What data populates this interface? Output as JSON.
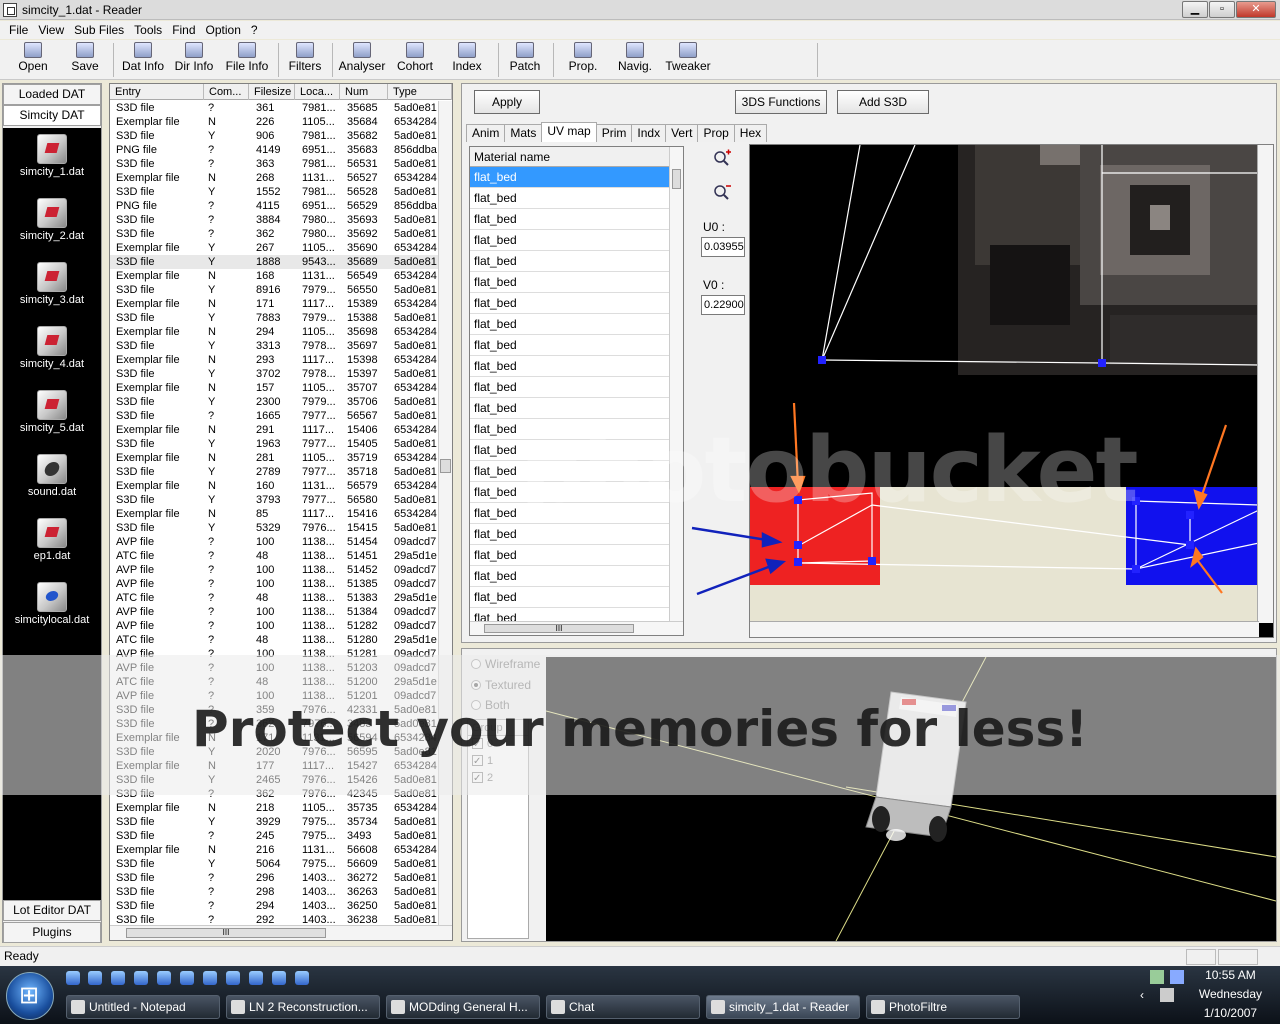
{
  "window": {
    "title": "simcity_1.dat - Reader",
    "btn_min": "▁",
    "btn_max": "▫",
    "btn_close": "✕"
  },
  "menu": [
    "File",
    "View",
    "Sub Files",
    "Tools",
    "Find",
    "Option",
    "?"
  ],
  "toolbar": {
    "buttons": [
      "Open",
      "Save",
      "Dat Info",
      "Dir Info",
      "File Info",
      "Filters",
      "Analyser",
      "Cohort",
      "Index",
      "Patch",
      "Prop.",
      "Navig.",
      "Tweaker"
    ]
  },
  "left_panel": {
    "tab_loaded": "Loaded DAT",
    "tab_simcity": "Simcity DAT",
    "files": [
      "simcity_1.dat",
      "simcity_2.dat",
      "simcity_3.dat",
      "simcity_4.dat",
      "simcity_5.dat",
      "sound.dat",
      "ep1.dat",
      "simcitylocal.dat"
    ],
    "tab_lot_editor": "Lot Editor DAT",
    "tab_plugins": "Plugins"
  },
  "entry_list": {
    "headers": [
      "Entry",
      "Com...",
      "Filesize",
      "Loca...",
      "Num",
      "Type"
    ],
    "rows": [
      [
        "S3D file",
        "?",
        "361",
        "7981...",
        "35685",
        "5ad0e81"
      ],
      [
        "Exemplar file",
        "N",
        "226",
        "1105...",
        "35684",
        "6534284"
      ],
      [
        "S3D file",
        "Y",
        "906",
        "7981...",
        "35682",
        "5ad0e81"
      ],
      [
        "PNG file",
        "?",
        "4149",
        "6951...",
        "35683",
        "856ddba"
      ],
      [
        "S3D file",
        "?",
        "363",
        "7981...",
        "56531",
        "5ad0e81"
      ],
      [
        "Exemplar file",
        "N",
        "268",
        "1131...",
        "56527",
        "6534284"
      ],
      [
        "S3D file",
        "Y",
        "1552",
        "7981...",
        "56528",
        "5ad0e81"
      ],
      [
        "PNG file",
        "?",
        "4115",
        "6951...",
        "56529",
        "856ddba"
      ],
      [
        "S3D file",
        "?",
        "3884",
        "7980...",
        "35693",
        "5ad0e81"
      ],
      [
        "S3D file",
        "?",
        "362",
        "7980...",
        "35692",
        "5ad0e81"
      ],
      [
        "Exemplar file",
        "Y",
        "267",
        "1105...",
        "35690",
        "6534284"
      ],
      [
        "S3D file",
        "Y",
        "1888",
        "9543...",
        "35689",
        "5ad0e81"
      ],
      [
        "Exemplar file",
        "N",
        "168",
        "1131...",
        "56549",
        "6534284"
      ],
      [
        "S3D file",
        "Y",
        "8916",
        "7979...",
        "56550",
        "5ad0e81"
      ],
      [
        "Exemplar file",
        "N",
        "171",
        "1117...",
        "15389",
        "6534284"
      ],
      [
        "S3D file",
        "Y",
        "7883",
        "7979...",
        "15388",
        "5ad0e81"
      ],
      [
        "Exemplar file",
        "N",
        "294",
        "1105...",
        "35698",
        "6534284"
      ],
      [
        "S3D file",
        "Y",
        "3313",
        "7978...",
        "35697",
        "5ad0e81"
      ],
      [
        "Exemplar file",
        "N",
        "293",
        "1117...",
        "15398",
        "6534284"
      ],
      [
        "S3D file",
        "Y",
        "3702",
        "7978...",
        "15397",
        "5ad0e81"
      ],
      [
        "Exemplar file",
        "N",
        "157",
        "1105...",
        "35707",
        "6534284"
      ],
      [
        "S3D file",
        "Y",
        "2300",
        "7979...",
        "35706",
        "5ad0e81"
      ],
      [
        "S3D file",
        "?",
        "1665",
        "7977...",
        "56567",
        "5ad0e81"
      ],
      [
        "Exemplar file",
        "N",
        "291",
        "1117...",
        "15406",
        "6534284"
      ],
      [
        "S3D file",
        "Y",
        "1963",
        "7977...",
        "15405",
        "5ad0e81"
      ],
      [
        "Exemplar file",
        "N",
        "281",
        "1105...",
        "35719",
        "6534284"
      ],
      [
        "S3D file",
        "Y",
        "2789",
        "7977...",
        "35718",
        "5ad0e81"
      ],
      [
        "Exemplar file",
        "N",
        "160",
        "1131...",
        "56579",
        "6534284"
      ],
      [
        "S3D file",
        "Y",
        "3793",
        "7977...",
        "56580",
        "5ad0e81"
      ],
      [
        "Exemplar file",
        "N",
        "85",
        "1117...",
        "15416",
        "6534284"
      ],
      [
        "S3D file",
        "Y",
        "5329",
        "7976...",
        "15415",
        "5ad0e81"
      ],
      [
        "AVP file",
        "?",
        "100",
        "1138...",
        "51454",
        "09adcd7"
      ],
      [
        "ATC file",
        "?",
        "48",
        "1138...",
        "51451",
        "29a5d1e"
      ],
      [
        "AVP file",
        "?",
        "100",
        "1138...",
        "51452",
        "09adcd7"
      ],
      [
        "AVP file",
        "?",
        "100",
        "1138...",
        "51385",
        "09adcd7"
      ],
      [
        "ATC file",
        "?",
        "48",
        "1138...",
        "51383",
        "29a5d1e"
      ],
      [
        "AVP file",
        "?",
        "100",
        "1138...",
        "51384",
        "09adcd7"
      ],
      [
        "AVP file",
        "?",
        "100",
        "1138...",
        "51282",
        "09adcd7"
      ],
      [
        "ATC file",
        "?",
        "48",
        "1138...",
        "51280",
        "29a5d1e"
      ],
      [
        "AVP file",
        "?",
        "100",
        "1138...",
        "51281",
        "09adcd7"
      ],
      [
        "AVP file",
        "?",
        "100",
        "1138...",
        "51203",
        "09adcd7"
      ],
      [
        "ATC file",
        "?",
        "48",
        "1138...",
        "51200",
        "29a5d1e"
      ],
      [
        "AVP file",
        "?",
        "100",
        "1138...",
        "51201",
        "09adcd7"
      ],
      [
        "S3D file",
        "?",
        "359",
        "7976...",
        "42331",
        "5ad0e81"
      ],
      [
        "S3D file",
        "?",
        "362",
        "7976...",
        "3483",
        "5ad0e81"
      ],
      [
        "Exemplar file",
        "N",
        "171",
        "1131...",
        "56594",
        "6534284"
      ],
      [
        "S3D file",
        "Y",
        "2020",
        "7976...",
        "56595",
        "5ad0e81"
      ],
      [
        "Exemplar file",
        "N",
        "177",
        "1117...",
        "15427",
        "6534284"
      ],
      [
        "S3D file",
        "Y",
        "2465",
        "7976...",
        "15426",
        "5ad0e81"
      ],
      [
        "S3D file",
        "?",
        "362",
        "7976...",
        "42345",
        "5ad0e81"
      ],
      [
        "Exemplar file",
        "N",
        "218",
        "1105...",
        "35735",
        "6534284"
      ],
      [
        "S3D file",
        "Y",
        "3929",
        "7975...",
        "35734",
        "5ad0e81"
      ],
      [
        "S3D file",
        "?",
        "245",
        "7975...",
        "3493",
        "5ad0e81"
      ],
      [
        "Exemplar file",
        "N",
        "216",
        "1131...",
        "56608",
        "6534284"
      ],
      [
        "S3D file",
        "Y",
        "5064",
        "7975...",
        "56609",
        "5ad0e81"
      ],
      [
        "S3D file",
        "?",
        "296",
        "1403...",
        "36272",
        "5ad0e81"
      ],
      [
        "S3D file",
        "?",
        "298",
        "1403...",
        "36263",
        "5ad0e81"
      ],
      [
        "S3D file",
        "?",
        "294",
        "1403...",
        "36250",
        "5ad0e81"
      ],
      [
        "S3D file",
        "?",
        "292",
        "1403...",
        "36238",
        "5ad0e81"
      ]
    ],
    "selected_row": 11,
    "hscroll_grip": "III"
  },
  "s3d_panel": {
    "apply": "Apply",
    "functions_3ds": "3DS Functions",
    "add_s3d": "Add S3D",
    "tabs": [
      "Anim",
      "Mats",
      "UV map",
      "Prim",
      "Indx",
      "Vert",
      "Prop",
      "Hex"
    ],
    "active_tab": "UV map",
    "material_header": "Material name",
    "materials": [
      "flat_bed",
      "flat_bed",
      "flat_bed",
      "flat_bed",
      "flat_bed",
      "flat_bed",
      "flat_bed",
      "flat_bed",
      "flat_bed",
      "flat_bed",
      "flat_bed",
      "flat_bed",
      "flat_bed",
      "flat_bed",
      "flat_bed",
      "flat_bed",
      "flat_bed",
      "flat_bed",
      "flat_bed",
      "flat_bed",
      "flat_bed",
      "flat_bed"
    ],
    "last_material": "flat_bed",
    "mat_hscroll_grip": "III",
    "u0_label": "U0 :",
    "u0_value": "0.039557",
    "v0_label": "V0 :",
    "v0_value": "0.229004"
  },
  "view3d_panel": {
    "wireframe": "Wireframe",
    "textured": "Textured",
    "both": "Both",
    "group_header": "Group",
    "groups": [
      "0",
      "1",
      "2"
    ]
  },
  "watermark": {
    "text": "Protect your memories for less!",
    "logo": "photobucket"
  },
  "status": {
    "text": "Ready"
  },
  "taskbar": {
    "tasks": [
      "Untitled - Notepad",
      "LN 2 Reconstruction...",
      "MODding General H...",
      "Chat",
      "simcity_1.dat - Reader",
      "PhotoFiltre"
    ],
    "active_task": "simcity_1.dat - Reader",
    "time": "10:55 AM",
    "day": "Wednesday",
    "date": "1/10/2007"
  }
}
